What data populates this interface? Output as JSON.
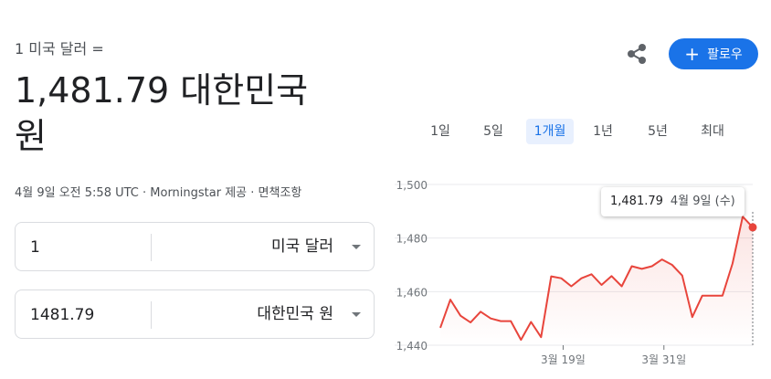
{
  "header": {
    "subtitle": "1 미국 달러 =",
    "rate_line1": "1,481.79 대한민국",
    "rate_line2": "원",
    "meta": "4월 9일 오전 5:58 UTC · Morningstar 제공 · 면책조항"
  },
  "converter": {
    "from_value": "1",
    "from_currency": "미국 달러",
    "to_value": "1481.79",
    "to_currency": "대한민국 원"
  },
  "actions": {
    "share_icon": "share-icon",
    "follow_label": "팔로우",
    "follow_color": "#1a73e8"
  },
  "ranges": [
    {
      "label": "1일",
      "active": false
    },
    {
      "label": "5일",
      "active": false
    },
    {
      "label": "1개월",
      "active": true
    },
    {
      "label": "1년",
      "active": false
    },
    {
      "label": "5년",
      "active": false
    },
    {
      "label": "최대",
      "active": false
    }
  ],
  "tooltip": {
    "value": "1,481.79",
    "date": "4월 9일 (수)"
  },
  "chart_data": {
    "type": "line",
    "color": "#e8453c",
    "ylim": [
      1440,
      1500
    ],
    "yticks": [
      "1,500",
      "1,480",
      "1,460",
      "1,440"
    ],
    "xticks": [
      "3월 19일",
      "3월 31일"
    ],
    "values": [
      1446.5,
      1457,
      1451,
      1448.5,
      1452.5,
      1450,
      1449,
      1449,
      1442,
      1448.7,
      1443,
      1465.7,
      1465,
      1462,
      1465,
      1466.5,
      1462.5,
      1465.8,
      1462,
      1469.5,
      1468.5,
      1469.5,
      1472,
      1470,
      1466,
      1450.5,
      1458.5,
      1458.5,
      1458.5,
      1470.5,
      1488,
      1484
    ]
  }
}
